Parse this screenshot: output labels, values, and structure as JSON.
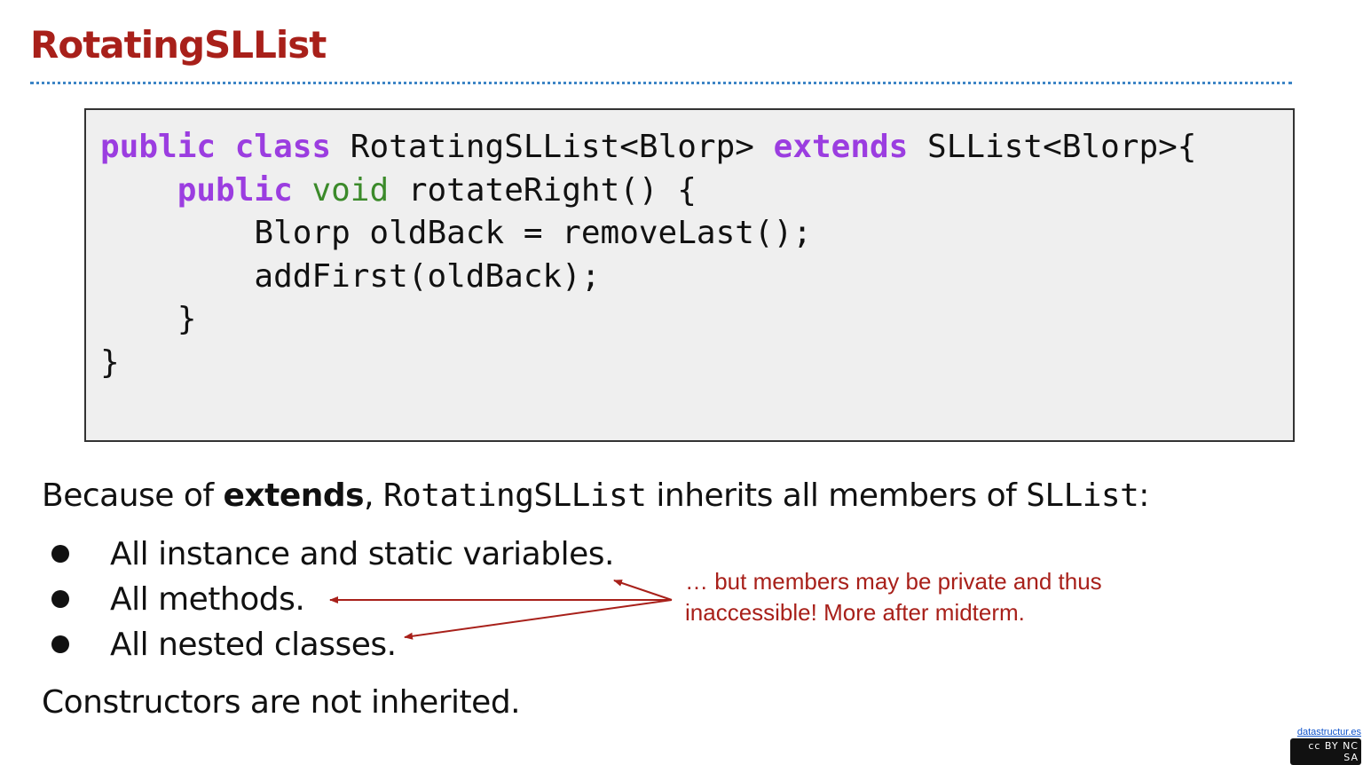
{
  "slide": {
    "title": "RotatingSLList"
  },
  "code": {
    "l1": {
      "kw1": "public",
      "kw2": "class",
      "t1": "RotatingSLList<Blorp>",
      "kw3": "extends",
      "t2": "SLList<Blorp>{"
    },
    "l2": {
      "kw1": "public",
      "ty": "void",
      "t1": "rotateRight() {"
    },
    "l3": {
      "t1": "Blorp oldBack = removeLast();"
    },
    "l4": {
      "t1": "addFirst(oldBack);"
    },
    "l5": {
      "t1": "}"
    },
    "l6": {
      "t1": "}"
    }
  },
  "intro": {
    "prefix": "Because of ",
    "bold": "extends",
    "comma": ", ",
    "cls1": "RotatingSLList",
    "mid": " inherits all members of ",
    "cls2": "SLList",
    "suffix": ":"
  },
  "bullets": [
    "All instance and static variables.",
    "All methods.",
    "All nested classes."
  ],
  "note": {
    "line1": "… but members may be private and thus",
    "line2": "inaccessible! More after midterm."
  },
  "footer_text": "Constructors are not inherited.",
  "badge": {
    "link": "datastructur.es",
    "license": "cc BY NC SA"
  },
  "colors": {
    "title": "#a8201a",
    "keyword": "#9b3de0",
    "type": "#3b8a2a",
    "rule": "#3d85c6",
    "note": "#a8201a"
  }
}
